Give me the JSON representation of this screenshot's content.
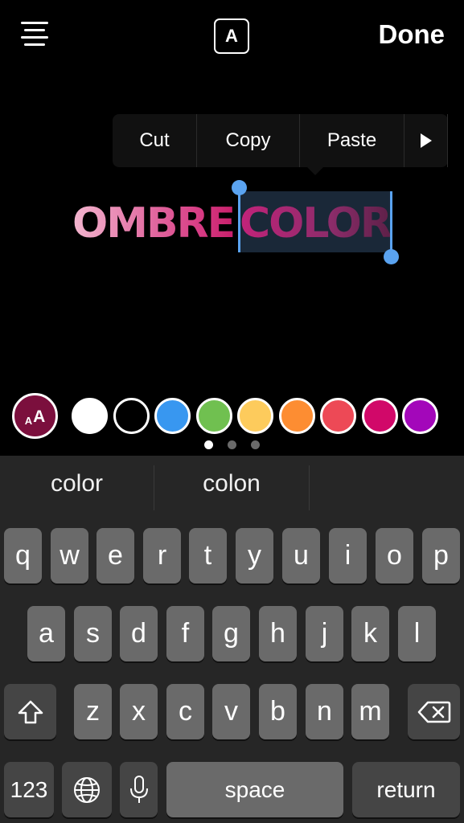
{
  "toolbar": {
    "done_label": "Done",
    "font_button_label": "A"
  },
  "edit_menu": {
    "items": [
      "Cut",
      "Copy",
      "Paste"
    ],
    "more_icon": "play-triangle-icon"
  },
  "text": {
    "word1": "OMBRE",
    "word2": "COLOR"
  },
  "palette": {
    "aa_small": "A",
    "aa_large": "A",
    "aa_color": "#7b0f3d",
    "colors": [
      "#ffffff",
      "#000000",
      "#3897f0",
      "#70c050",
      "#fdcb5c",
      "#fd8d32",
      "#ed4956",
      "#d10869",
      "#a307ba"
    ],
    "pages": 3,
    "active_page": 1
  },
  "keyboard": {
    "suggestions": [
      "color",
      "colon",
      ""
    ],
    "row1": [
      "q",
      "w",
      "e",
      "r",
      "t",
      "y",
      "u",
      "i",
      "o",
      "p"
    ],
    "row2": [
      "a",
      "s",
      "d",
      "f",
      "g",
      "h",
      "j",
      "k",
      "l"
    ],
    "row3": [
      "z",
      "x",
      "c",
      "v",
      "b",
      "n",
      "m"
    ],
    "numbers_label": "123",
    "space_label": "space",
    "return_label": "return"
  }
}
